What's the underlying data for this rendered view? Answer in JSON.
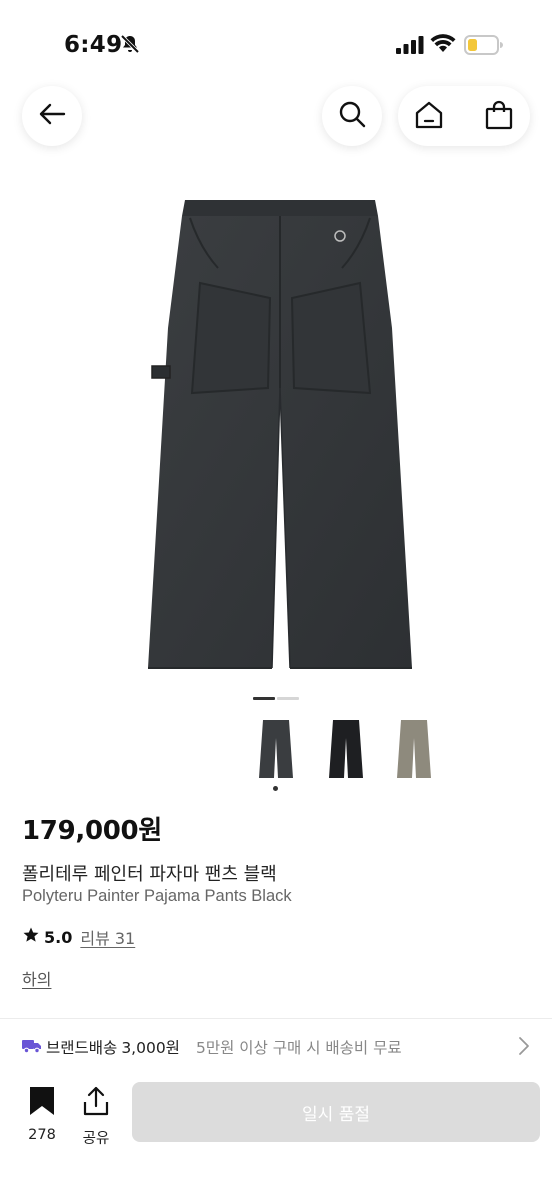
{
  "status_bar": {
    "time": "6:49",
    "icons": [
      "bell-slash-icon",
      "signal-icon",
      "wifi-icon",
      "battery-low-icon"
    ]
  },
  "nav": {
    "icons": [
      "back-arrow-icon",
      "search-icon",
      "home-icon",
      "shopping-bag-icon"
    ]
  },
  "gallery": {
    "pages": 2,
    "current_page": 1,
    "colors": [
      {
        "icon": "pants-charcoal",
        "hex": "#3a3d40",
        "selected": true
      },
      {
        "icon": "pants-black",
        "hex": "#1e1f22",
        "selected": false
      },
      {
        "icon": "pants-khaki",
        "hex": "#8e8a7d",
        "selected": false
      }
    ]
  },
  "product": {
    "price": "179,000원",
    "name_ko": "폴리테루 페인터 파자마 팬츠 블랙",
    "name_en": "Polyteru Painter Pajama Pants Black",
    "rating": "5.0",
    "review_label": "리뷰 31",
    "category": "하의"
  },
  "shipping": {
    "label": "브랜드배송",
    "fee": "3,000원",
    "note": "5만원 이상 구매 시 배송비 무료"
  },
  "bottom_bar": {
    "bookmark_count": "278",
    "share_label": "공유",
    "soldout_label": "일시 품절"
  },
  "colors": {
    "shipping_icon": "#6a55d6",
    "soldout_bg": "#dcdcdc"
  }
}
